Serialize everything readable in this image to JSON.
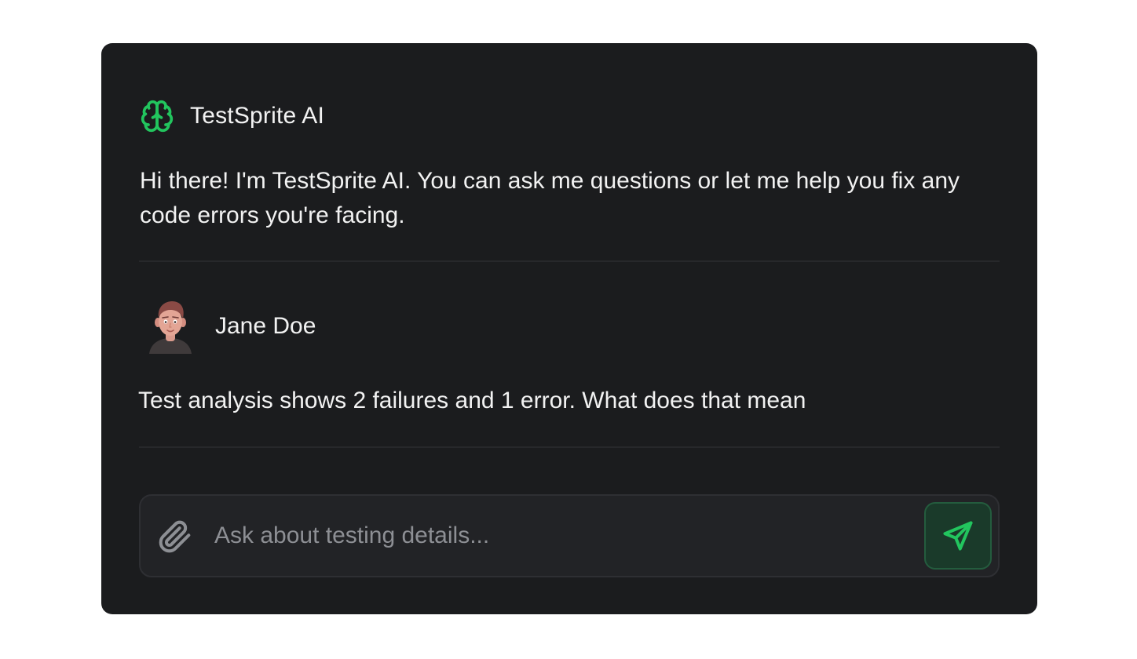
{
  "assistant": {
    "name": "TestSprite AI",
    "icon": "brain-icon",
    "message": "Hi there! I'm TestSprite AI. You can ask me questions or let me help you fix any code errors you're facing."
  },
  "user": {
    "name": "Jane Doe",
    "avatar": "avatar",
    "message": "Test analysis shows 2 failures and 1 error. What does that mean"
  },
  "composer": {
    "placeholder": "Ask about testing details...",
    "value": "",
    "attach_icon": "paperclip-icon",
    "send_icon": "send-icon"
  },
  "colors": {
    "card_background": "#1b1c1e",
    "accent_green": "#22c55e",
    "send_button_background": "#1a3a2a",
    "text_primary": "#f2f2f2",
    "placeholder_text": "#8d8f94"
  }
}
